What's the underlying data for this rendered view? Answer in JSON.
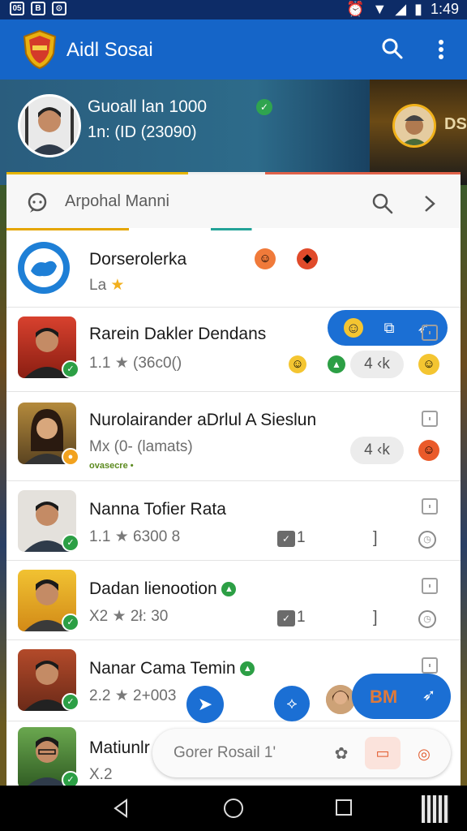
{
  "status_bar": {
    "left_a": "05",
    "left_b": "B",
    "left_c": "⊙",
    "time": "1:49"
  },
  "app_bar": {
    "title": "Aidl Sosai"
  },
  "banner": {
    "name": "Guoall lan 1000",
    "stats": "1n: (ID (23090)",
    "side_text": "DS"
  },
  "search": {
    "placeholder": "Arpohal Manni"
  },
  "rows": [
    {
      "name": "Dorserolerka",
      "sub": "La",
      "star": "★"
    },
    {
      "name": "Rarein Dakler Dendans",
      "sub": "1.1",
      "star": "★",
      "sub2": "(36c0()",
      "pill": "4 ‹k"
    },
    {
      "name": "Nurolairander aDrlul A Sieslun",
      "sub": "Mx (0- (lamats)",
      "tag": "ovasecre •",
      "pill": "4 ‹k"
    },
    {
      "name": "Nanna Tofier Rata",
      "sub": "1.1",
      "star": "★",
      "sub2": "6300 8",
      "count": "1",
      "bracket": "]"
    },
    {
      "name": "Dadan lienootion",
      "sub": "X2",
      "star": "★",
      "sub2": "2ł: 30",
      "count": "1",
      "bracket": "]"
    },
    {
      "name": "Nanar Cama Temin",
      "sub": "2.2",
      "star": "★",
      "sub2": "2+003"
    },
    {
      "name": "Matiunlr",
      "sub": "X.2"
    }
  ],
  "bottom": {
    "pill_label": "BM",
    "compose_text": "Gorer Rosail 1'"
  },
  "colors": {
    "primary": "#1565c8",
    "accent": "#1b6fd4",
    "online": "#2c9f45"
  }
}
